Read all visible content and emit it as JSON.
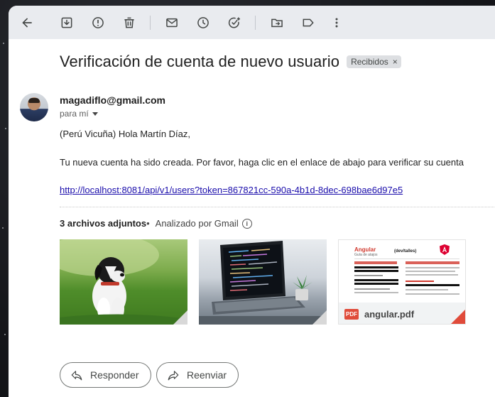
{
  "toolbar": {
    "icons": [
      "back-arrow-icon",
      "archive-icon",
      "report-spam-icon",
      "delete-icon",
      "mark-unread-icon",
      "snooze-icon",
      "add-task-icon",
      "move-to-icon",
      "label-icon",
      "more-icon"
    ]
  },
  "email": {
    "subject": "Verificación de cuenta de nuevo usuario",
    "label": "Recibidos",
    "label_close": "×",
    "sender": "magadiflo@gmail.com",
    "to": "para mí",
    "greeting": "(Perú Vicuña) Hola Martín Díaz,",
    "message": "Tu nueva cuenta ha sido creada. Por favor, haga clic en el enlace de abajo para verificar su cuenta",
    "link": "http://localhost:8081/api/v1/users?token=867821cc-590a-4b1d-8dec-698bae6d97e5"
  },
  "attachments": {
    "count_label": "3 archivos adjuntos",
    "bullet": "•",
    "scanned": "Analizado por Gmail",
    "files": [
      {
        "type": "image",
        "description": "dog-photo"
      },
      {
        "type": "image",
        "description": "laptop-photo"
      },
      {
        "type": "pdf",
        "name": "angular.pdf",
        "badge": "PDF",
        "preview_title": "Angular",
        "preview_subtitle": "Guía de atajos",
        "preview_brand": "(dev/talles)"
      }
    ]
  },
  "actions": {
    "reply": "Responder",
    "forward": "Reenviar"
  },
  "colors": {
    "link": "#1a0dab",
    "pdf_red": "#e04b3a",
    "toolbar_bg": "#e9ebef"
  }
}
